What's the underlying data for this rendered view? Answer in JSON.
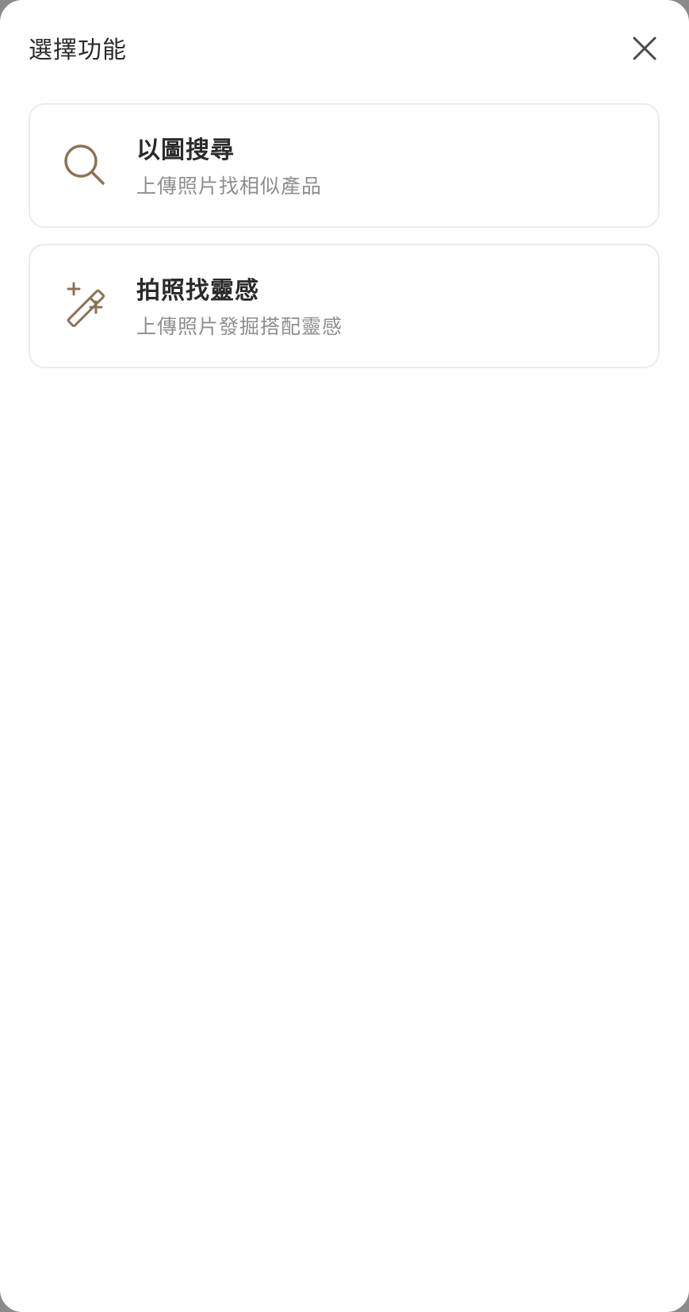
{
  "sheet": {
    "title": "選擇功能",
    "close_icon": "close-icon"
  },
  "options": [
    {
      "title": "以圖搜尋",
      "subtitle": "上傳照片找相似產品",
      "icon": "search-icon"
    },
    {
      "title": "拍照找靈感",
      "subtitle": "上傳照片發掘搭配靈感",
      "icon": "magic-wand-icon"
    }
  ],
  "colors": {
    "icon_accent": "#8b7355",
    "close_icon": "#4a4a4a",
    "title_text": "#2a2a2a",
    "subtitle_text": "#8e8e8e",
    "card_border": "#ebebeb"
  }
}
